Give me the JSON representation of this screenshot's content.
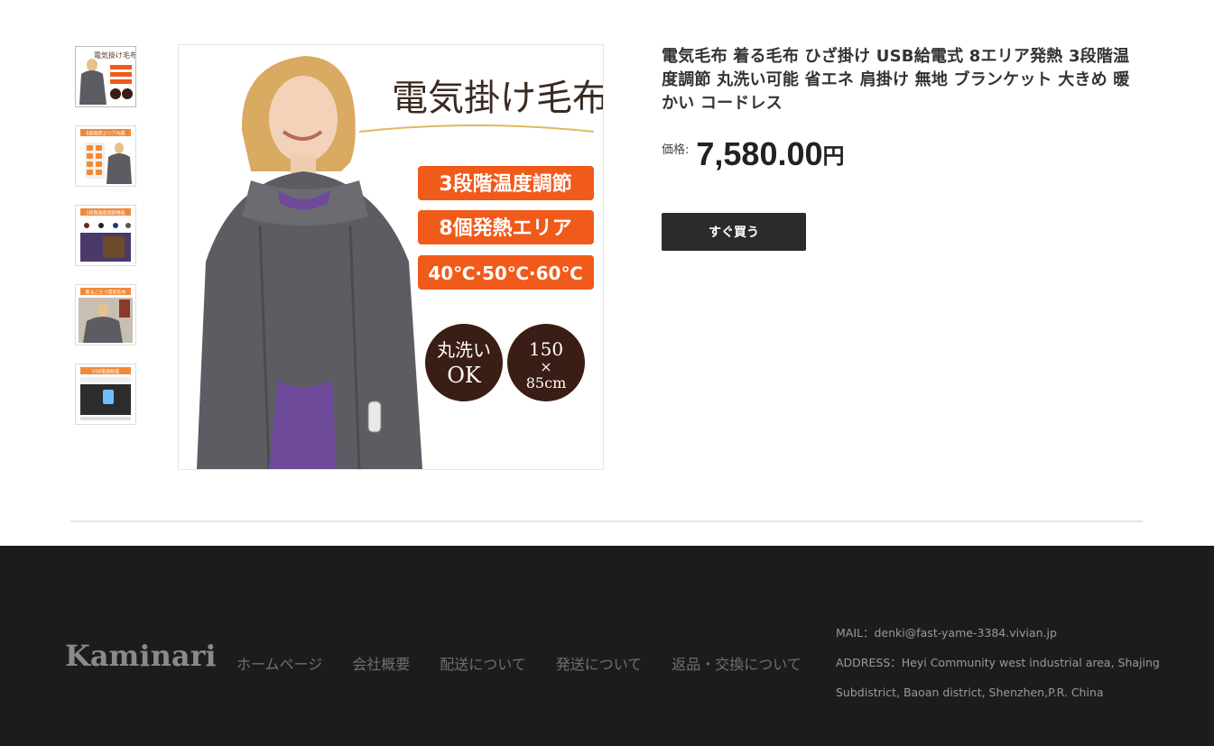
{
  "product": {
    "title": "電気毛布 着る毛布 ひざ掛け USB給電式 8エリア発熱 3段階温度調節 丸洗い可能 省エネ 肩掛け 無地 ブランケット 大きめ 暖かい コードレス",
    "price_label": "価格:",
    "price_value": "7,580.00",
    "price_unit": "円",
    "buy_label": "すぐ買う",
    "image": {
      "heading": "電気掛け毛布",
      "features": [
        "3段階温度調節",
        "8個発熱エリア",
        "40℃·50℃·60℃"
      ],
      "badge_wash": [
        "丸洗い",
        "OK"
      ],
      "badge_size": [
        "150",
        "×",
        "85cm"
      ]
    },
    "thumbnails": [
      {
        "heading": "電気掛け毛布"
      },
      {
        "heading": "8個発熱エリア内蔵"
      },
      {
        "heading": "3段階温度調節機能"
      },
      {
        "heading": "着るこたつ電気毛布"
      },
      {
        "heading": "USB電源給電"
      }
    ]
  },
  "footer": {
    "logo": "Kaminari",
    "nav": [
      "ホームページ",
      "会社概要",
      "配送について",
      "発送について",
      "返品・交換について"
    ],
    "mail": "MAIL：denki@fast-yame-3384.vivian.jp",
    "address": "ADDRESS：Heyi Community west industrial area, Shajing Subdistrict, Baoan district, Shenzhen,P.R. China"
  },
  "colors": {
    "orange_label": "#f05a1a",
    "badge_dark": "#3a1d14",
    "blanket": "#5b5d63",
    "footer_bg": "#1c1c1c",
    "button_bg": "#2b2b2b"
  }
}
